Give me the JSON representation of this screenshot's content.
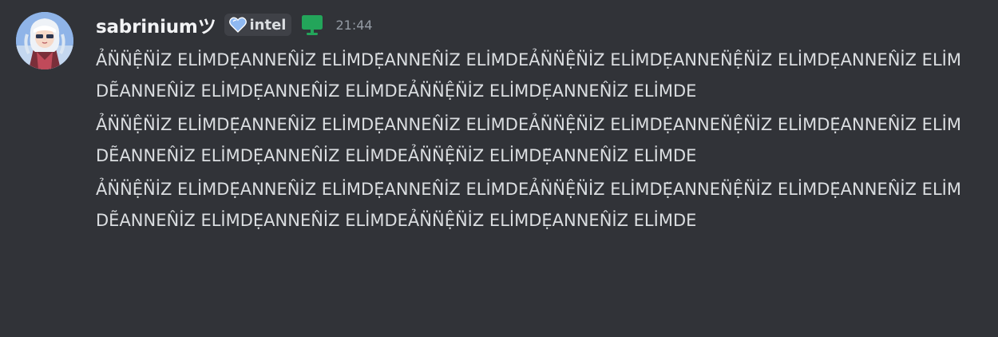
{
  "message": {
    "username": "sabriniumツ",
    "guild_tag": "intel",
    "timestamp": "21:44",
    "paragraphs": [
      "ẢN̈N̈ỆN̈İZ ELİMDẸ̈ANNEN̂İZ ELİMDẸ̈ANNEN̂İZ ELİMDEẢN̈N̈ỆN̈İZ ELİMDẸ̈ANNEN̈ỆN̈İZ ELİMDẸ̈ANNEN̂İZ ELİMDẼANNEN̂İZ ELİMDẸ̈ANNEN̂İZ ELİMDEẢN̈N̈ỆN̈İZ ELİMDẸ̈ANNEN̂İZ ELİMDE",
      "ẢN̈N̈ỆN̈İZ ELİMDẸ̈ANNEN̂İZ ELİMDẸ̈ANNEN̂İZ ELİMDEẢN̈N̈ỆN̈İZ ELİMDẸ̈ANNEN̈ỆN̈İZ ELİMDẸ̈ANNEN̂İZ ELİMDẼANNEN̂İZ ELİMDẸ̈ANNEN̂İZ ELİMDEẢN̈N̈ỆN̈İZ ELİMDẸ̈ANNEN̂İZ ELİMDE",
      "ẢN̈N̈ỆN̈İZ ELİMDẸ̈ANNEN̂İZ ELİMDẸ̈ANNEN̂İZ ELİMDEẢN̈N̈ỆN̈İZ ELİMDẸ̈ANNEN̈ỆN̈İZ ELİMDẸ̈ANNEN̂İZ ELİMDẼANNEN̂İZ ELİMDẸ̈ANNEN̂İZ ELİMDEẢN̈N̈ỆN̈İZ ELİMDẸ̈ANNEN̂İZ ELİMDE"
    ]
  },
  "icons": {
    "avatar": "avatar-image",
    "guild_badge": "heart-icon",
    "platform": "desktop-icon"
  },
  "colors": {
    "background": "#313338",
    "username": "#f2f3f5",
    "text": "#dbdee1",
    "timestamp": "#949ba4",
    "tag_background": "#3f4147",
    "desktop_icon": "#23a55a",
    "heart": "#8fb8f0"
  }
}
